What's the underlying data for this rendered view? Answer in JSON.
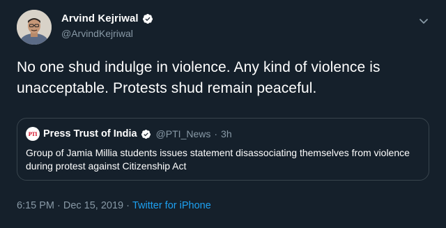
{
  "author": {
    "display_name": "Arvind Kejriwal",
    "handle": "@ArvindKejriwal",
    "verified": true,
    "avatar_icon": "profile-photo"
  },
  "tweet": {
    "text": "No one shud indulge in violence. Any kind of violence is unacceptable. Protests shud remain peaceful."
  },
  "quoted_tweet": {
    "logo_text": "PTI",
    "display_name": "Press Trust of India",
    "verified": true,
    "handle": "@PTI_News",
    "separator": "·",
    "time": "3h",
    "text": "Group of Jamia Millia students issues statement disassociating themselves from violence during protest against Citizenship Act"
  },
  "meta": {
    "time": "6:15 PM",
    "separator1": "·",
    "date": "Dec 15, 2019",
    "separator2": "·",
    "source": "Twitter for iPhone"
  },
  "colors": {
    "background": "#15202b",
    "muted": "#8899a6",
    "link": "#1da1f2",
    "border": "#38444d",
    "verified_badge": "#ffffff"
  }
}
